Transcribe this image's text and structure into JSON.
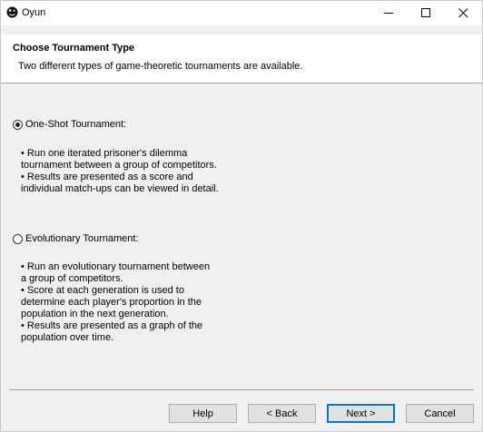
{
  "window": {
    "title": "Oyun",
    "icon": "app-ball-icon"
  },
  "window_controls": {
    "minimize_icon": "minimize-icon",
    "maximize_icon": "maximize-icon",
    "close_icon": "close-icon"
  },
  "header": {
    "title": "Choose Tournament Type",
    "description": "Two different types of game-theoretic tournaments are available."
  },
  "options": [
    {
      "label": "One-Shot Tournament:",
      "selected": true,
      "description_lines": [
        "• Run one iterated prisoner's dilemma",
        "tournament between a group of competitors.",
        "• Results are presented as a score and",
        "individual match-ups can be viewed in detail."
      ]
    },
    {
      "label": "Evolutionary Tournament:",
      "selected": false,
      "description_lines": [
        "• Run an evolutionary tournament between",
        "a group of competitors.",
        "• Score at each generation is used to",
        "determine each player's proportion in the",
        "population in the next generation.",
        "• Results are presented as a graph of the",
        "population over time."
      ]
    }
  ],
  "buttons": {
    "help": "Help",
    "back": "< Back",
    "next": "Next >",
    "cancel": "Cancel"
  },
  "colors": {
    "focus_border": "#0078d7",
    "dialog_background": "#f0f0f0",
    "header_background": "#ffffff"
  }
}
